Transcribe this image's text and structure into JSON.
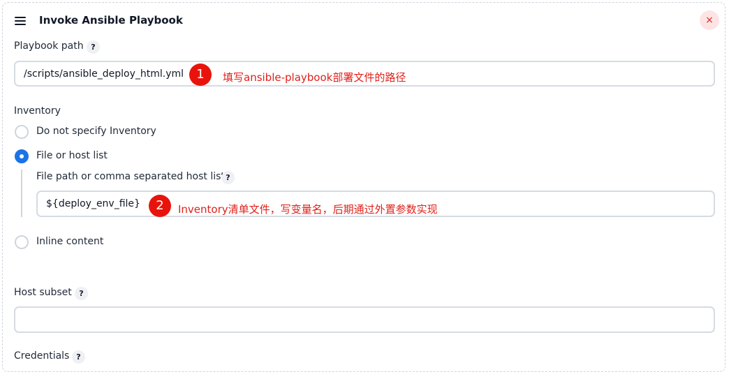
{
  "header": {
    "title": "Invoke Ansible Playbook",
    "close_label": "×"
  },
  "fields": {
    "help_glyph": "?",
    "playbook_path": {
      "label": "Playbook path",
      "value": "/scripts/ansible_deploy_html.yml"
    },
    "inventory": {
      "label": "Inventory",
      "options": [
        {
          "label": "Do not specify Inventory",
          "checked": false
        },
        {
          "label": "File or host list",
          "checked": true
        },
        {
          "label": "Inline content",
          "checked": false
        }
      ],
      "file_list": {
        "label": "File path or comma separated host list",
        "value": "${deploy_env_file}"
      }
    },
    "host_subset": {
      "label": "Host subset",
      "value": ""
    },
    "credentials": {
      "label": "Credentials"
    }
  },
  "annotations": [
    {
      "number": "1",
      "text": "填写ansible-playbook部署文件的路径"
    },
    {
      "number": "2",
      "text": "Inventory清单文件，写变量名，后期通过外置参数实现"
    }
  ],
  "colors": {
    "accent": "#1a73e8",
    "annotation_red": "#e0201a",
    "close_bg": "#fde4e4"
  }
}
